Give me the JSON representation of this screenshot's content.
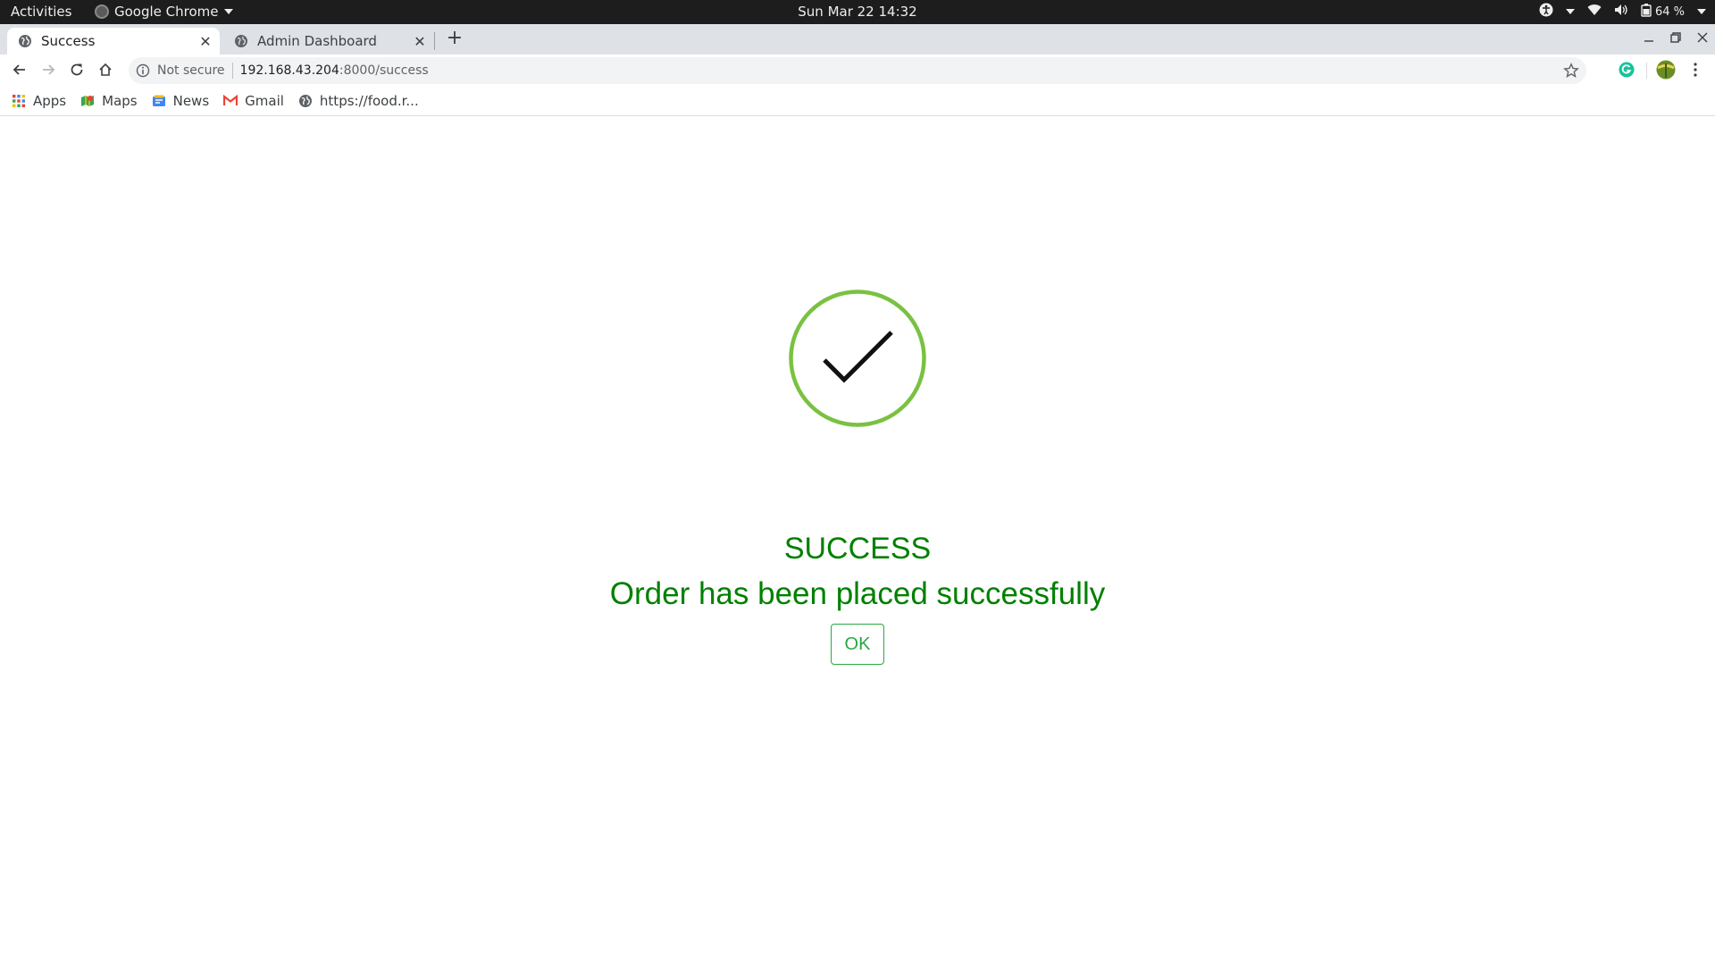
{
  "system_bar": {
    "activities": "Activities",
    "app_name": "Google Chrome",
    "clock": "Sun Mar 22  14:32",
    "battery": "64 %"
  },
  "tabs": [
    {
      "title": "Success",
      "active": true
    },
    {
      "title": "Admin Dashboard",
      "active": false
    }
  ],
  "address_bar": {
    "security_label": "Not secure",
    "url_host": "192.168.43.204",
    "url_path": ":8000/success"
  },
  "bookmarks": [
    {
      "label": "Apps",
      "icon": "apps-grid-icon"
    },
    {
      "label": "Maps",
      "icon": "maps-icon"
    },
    {
      "label": "News",
      "icon": "news-icon"
    },
    {
      "label": "Gmail",
      "icon": "gmail-icon"
    },
    {
      "label": "https://food.r...",
      "icon": "globe-icon"
    }
  ],
  "page": {
    "heading": "SUCCESS",
    "message": "Order has been placed successfully",
    "ok_label": "OK"
  },
  "colors": {
    "success_green": "#008000",
    "circle_green": "#7ac142",
    "button_green": "#28a745"
  }
}
